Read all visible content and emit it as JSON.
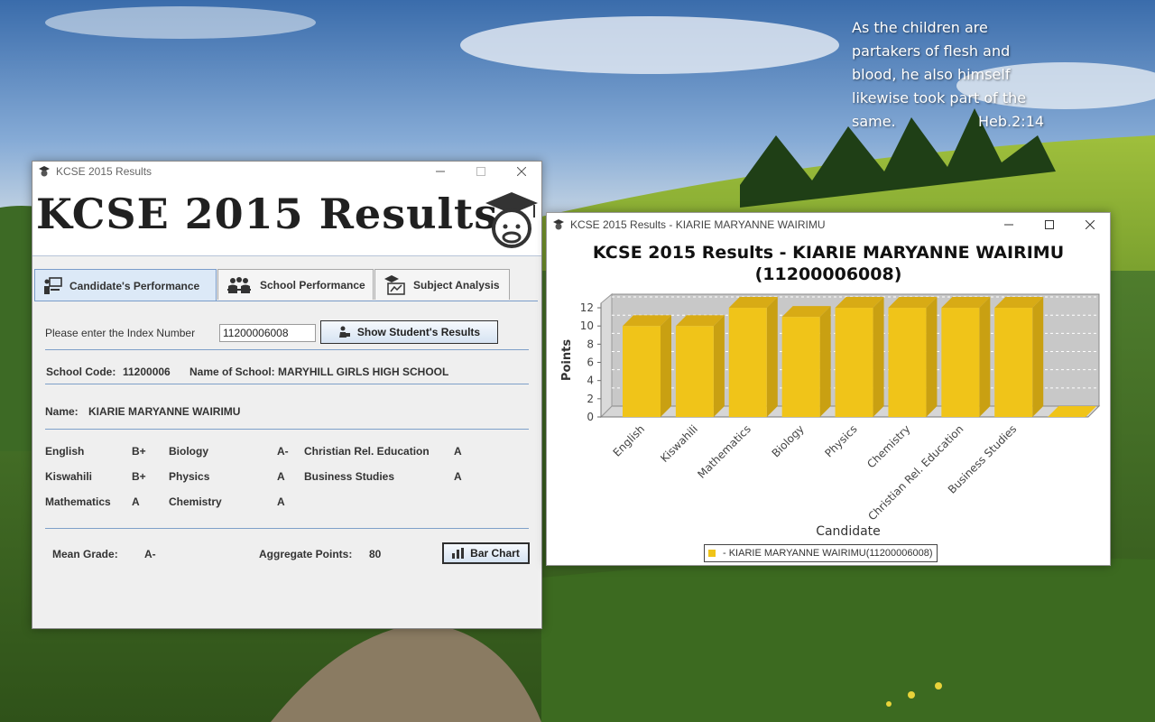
{
  "desktop": {
    "verse_lines": [
      "As the children are",
      "partakers of flesh and",
      "blood, he also himself",
      "likewise took part of the",
      "same."
    ],
    "verse_ref": "Heb.2:14"
  },
  "main_window": {
    "title": "KCSE 2015 Results",
    "banner_title": "KCSE 2015 Results",
    "tabs": [
      {
        "label": "Candidate's Performance",
        "icon": "teacher-icon",
        "active": true
      },
      {
        "label": "School Performance",
        "icon": "group-icon",
        "active": false
      },
      {
        "label": "Subject Analysis",
        "icon": "graduate-report-icon",
        "active": false
      }
    ],
    "index_prompt": "Please enter the Index Number",
    "index_value": "11200006008",
    "show_button": "Show Student's Results",
    "school_code_label": "School Code:",
    "school_code": "11200006",
    "school_name_label": "Name of School:",
    "school_name": "MARYHILL GIRLS HIGH SCHOOL",
    "name_label": "Name:",
    "student_name": "KIARIE MARYANNE WAIRIMU",
    "subjects": [
      {
        "subject": "English",
        "grade": "B+"
      },
      {
        "subject": "Kiswahili",
        "grade": "B+"
      },
      {
        "subject": "Mathematics",
        "grade": "A"
      },
      {
        "subject": "Biology",
        "grade": "A-"
      },
      {
        "subject": "Physics",
        "grade": "A"
      },
      {
        "subject": "Chemistry",
        "grade": "A"
      },
      {
        "subject": "Christian Rel. Education",
        "grade": "A"
      },
      {
        "subject": "Business Studies",
        "grade": "A"
      }
    ],
    "mean_grade_label": "Mean Grade:",
    "mean_grade": "A-",
    "aggregate_label": "Aggregate Points:",
    "aggregate_points": "80",
    "bar_chart_button": "Bar Chart"
  },
  "chart_window": {
    "title": "KCSE 2015 Results - KIARIE MARYANNE WAIRIMU",
    "legend": "- KIARIE MARYANNE WAIRIMU(11200006008)",
    "bar_color": "#f0c419"
  },
  "chart_data": {
    "type": "bar",
    "title": "KCSE 2015 Results - KIARIE MARYANNE WAIRIMU (11200006008)",
    "title_lines": [
      "KCSE 2015 Results - KIARIE MARYANNE WAIRIMU",
      "(11200006008)"
    ],
    "xlabel": "Candidate",
    "ylabel": "Points",
    "ylim": [
      0,
      12.5
    ],
    "yticks": [
      0,
      2,
      4,
      6,
      8,
      10,
      12
    ],
    "categories": [
      "English",
      "Kiswahili",
      "Mathematics",
      "Biology",
      "Physics",
      "Chemistry",
      "Christian Rel. Education",
      "Business Studies",
      ""
    ],
    "series": [
      {
        "name": "- KIARIE MARYANNE WAIRIMU(11200006008)",
        "values": [
          10,
          10,
          12,
          11,
          12,
          12,
          12,
          12,
          0
        ]
      }
    ],
    "grid": true,
    "legend_position": "bottom-center"
  }
}
